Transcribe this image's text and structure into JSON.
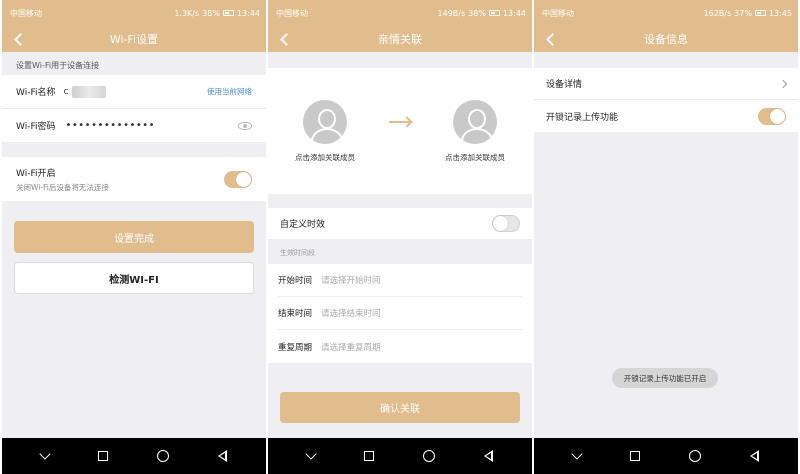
{
  "colors": {
    "accent": "#e1bc8c",
    "link": "#4a8fd9",
    "background": "#efeef3"
  },
  "screen1": {
    "status": {
      "carrier": "中国移动",
      "speed": "1.3K/s",
      "battery": "38%",
      "time": "13:44"
    },
    "title": "Wi-Fi设置",
    "section_label": "设置Wi-Fi用于设备连接",
    "wifi_name_label": "Wi-Fi名称",
    "wifi_name_value": "c",
    "use_current_network": "使用当前网络",
    "wifi_password_label": "Wi-Fi密码",
    "wifi_password_value": "••••••••••••••",
    "wifi_on_label": "Wi-Fi开启",
    "wifi_on_hint": "关闭Wi-Fi后设备将无法连接",
    "wifi_on_toggle": true,
    "done_button": "设置完成",
    "check_button": "检测WI-FI"
  },
  "screen2": {
    "status": {
      "carrier": "中国移动",
      "speed": "149B/s",
      "battery": "38%",
      "time": "13:44"
    },
    "title": "亲情关联",
    "add_member_left": "点击添加关联成员",
    "add_member_right": "点击添加关联成员",
    "custom_time_label": "自定义时效",
    "custom_time_toggle": false,
    "period_section": "生效时间段",
    "start_label": "开始时间",
    "start_placeholder": "请选择开始时间",
    "end_label": "结束时间",
    "end_placeholder": "请选择结束时间",
    "repeat_label": "重复周期",
    "repeat_placeholder": "请选择重复周期",
    "confirm_button": "确认关联"
  },
  "screen3": {
    "status": {
      "carrier": "中国移动",
      "speed": "162B/s",
      "battery": "37%",
      "time": "13:45"
    },
    "title": "设备信息",
    "device_details": "设备详情",
    "unlock_upload_label": "开锁记录上传功能",
    "unlock_upload_toggle": true,
    "toast": "开锁记录上传功能已开启"
  }
}
